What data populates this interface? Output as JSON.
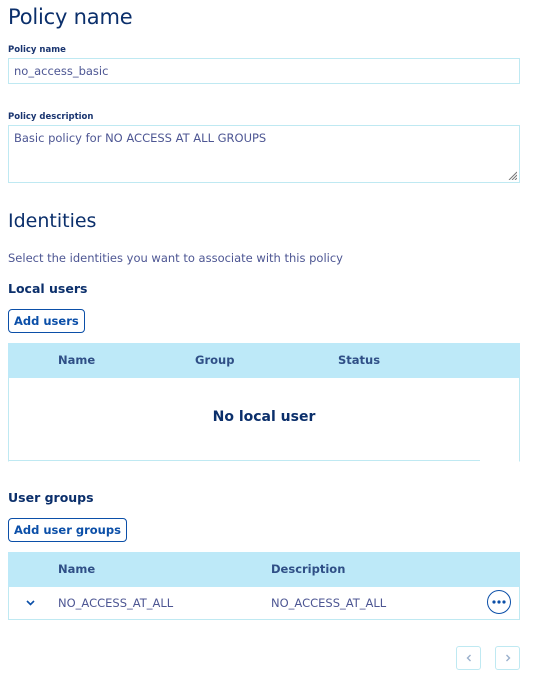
{
  "policy": {
    "title": "Policy name",
    "name_label": "Policy name",
    "name_value": "no_access_basic",
    "description_label": "Policy description",
    "description_value": "Basic policy for NO ACCESS AT ALL GROUPS"
  },
  "identities": {
    "title": "Identities",
    "subtitle": "Select the identities you want to associate with this policy",
    "local_users": {
      "title": "Local users",
      "add_button": "Add users",
      "columns": [
        "Name",
        "Group",
        "Status"
      ],
      "empty_text": "No local user"
    },
    "user_groups": {
      "title": "User groups",
      "add_button": "Add user groups",
      "columns": [
        "Name",
        "Description"
      ],
      "rows": [
        {
          "name": "NO_ACCESS_AT_ALL",
          "description": "NO_ACCESS_AT_ALL"
        }
      ]
    }
  },
  "icons": {
    "row_expand": "chevron-down-icon",
    "row_actions": "more-options-icon",
    "prev_page": "chevron-left-icon",
    "next_page": "chevron-right-icon"
  },
  "colors": {
    "heading": "#0b2f6b",
    "accent": "#0b4fa8",
    "table_header_bg": "#bde9f8",
    "border": "#bfe9f2"
  }
}
